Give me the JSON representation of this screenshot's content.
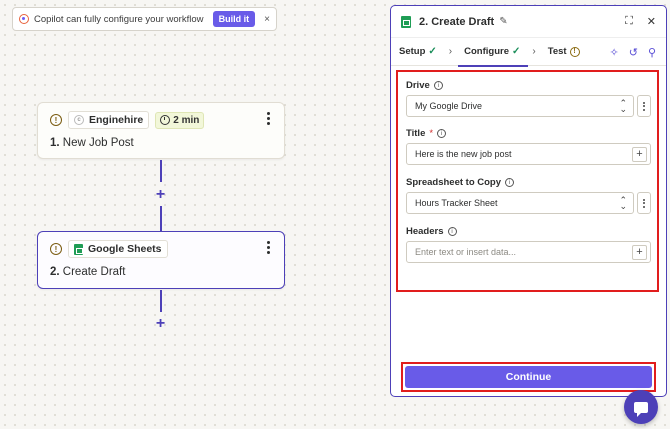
{
  "banner": {
    "text": "Copilot can fully configure your workflow",
    "build_label": "Build it",
    "close_label": "×"
  },
  "steps": [
    {
      "app": "Enginehire",
      "time": "2 min",
      "number": "1.",
      "title": "New Job Post"
    },
    {
      "app": "Google Sheets",
      "number": "2.",
      "title": "Create Draft"
    }
  ],
  "connector": {
    "plus": "+"
  },
  "panel": {
    "title": "2. Create Draft",
    "tabs": [
      {
        "label": "Setup",
        "status": "✓"
      },
      {
        "label": "Configure",
        "status": "✓"
      },
      {
        "label": "Test",
        "status": "!"
      }
    ],
    "separator": "›",
    "fields": {
      "drive": {
        "label": "Drive",
        "value": "My Google Drive"
      },
      "title": {
        "label": "Title",
        "required": "*",
        "value": "Here is the new job post"
      },
      "spreadsheet": {
        "label": "Spreadsheet to Copy",
        "value": "Hours Tracker Sheet"
      },
      "headers": {
        "label": "Headers",
        "placeholder": "Enter text or insert data..."
      }
    },
    "continue_label": "Continue"
  },
  "colors": {
    "accent": "#695be8",
    "brand_dark": "#4d40b8",
    "highlight": "#e11d1d",
    "success": "#1b8e5a"
  },
  "icons": [
    "warning-icon",
    "clock-icon",
    "sheets-icon",
    "pencil-icon",
    "expand-icon",
    "close-icon",
    "check-icon",
    "chevron-right-icon",
    "sparkle-icon",
    "undo-icon",
    "search-icon",
    "info-icon",
    "plus-icon",
    "kebab-icon",
    "chat-icon"
  ]
}
